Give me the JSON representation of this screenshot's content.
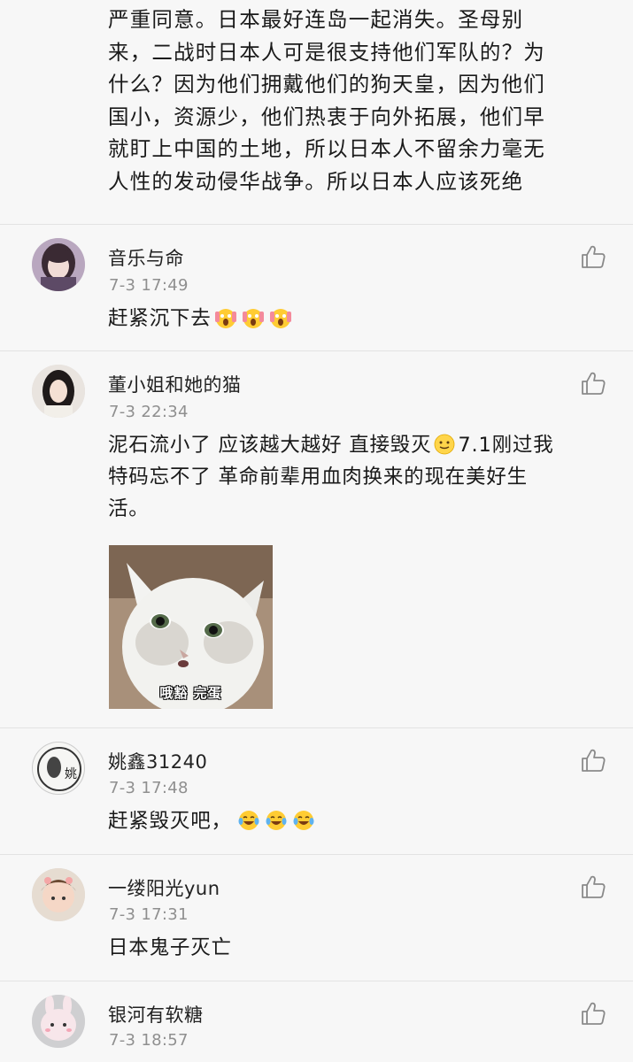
{
  "continued_comment": {
    "lines": [
      "严重同意。日本最好连岛一起消失。圣母别",
      "来，二战时日本人可是很支持他们军队的？为",
      "什么？因为他们拥戴他们的狗天皇，因为他们",
      "国小，资源少，他们热衷于向外拓展，他们早",
      "就盯上中国的土地，所以日本人不留余力毫无",
      "人性的发动侵华战争。所以日本人应该死绝"
    ]
  },
  "comments": [
    {
      "username": "音乐与命",
      "time": "7-3 17:49",
      "text": "赶紧沉下去",
      "emojis": [
        "scream-emoji",
        "scream-emoji",
        "scream-emoji"
      ]
    },
    {
      "username": "董小姐和她的猫",
      "time": "7-3 22:34",
      "text_part1": "泥石流小了 应该越大越好 直接毁灭",
      "text_part2": "7.1刚过我",
      "text_line2": "特码忘不了 革命前辈用血肉换来的现在美好生",
      "text_line3": "活。",
      "emojis": [
        "smile-emoji"
      ],
      "image_caption": "哦豁 完蛋"
    },
    {
      "username": "姚鑫31240",
      "time": "7-3 17:48",
      "text": "赶紧毁灭吧，",
      "emojis": [
        "tears-of-joy-emoji",
        "tears-of-joy-emoji",
        "tears-of-joy-emoji"
      ],
      "avatar_char": "姚"
    },
    {
      "username": "一缕阳光yun",
      "time": "7-3 17:31",
      "text": "日本鬼子灭亡"
    },
    {
      "username": "银河有软糖",
      "time": "7-3 18:57"
    }
  ]
}
